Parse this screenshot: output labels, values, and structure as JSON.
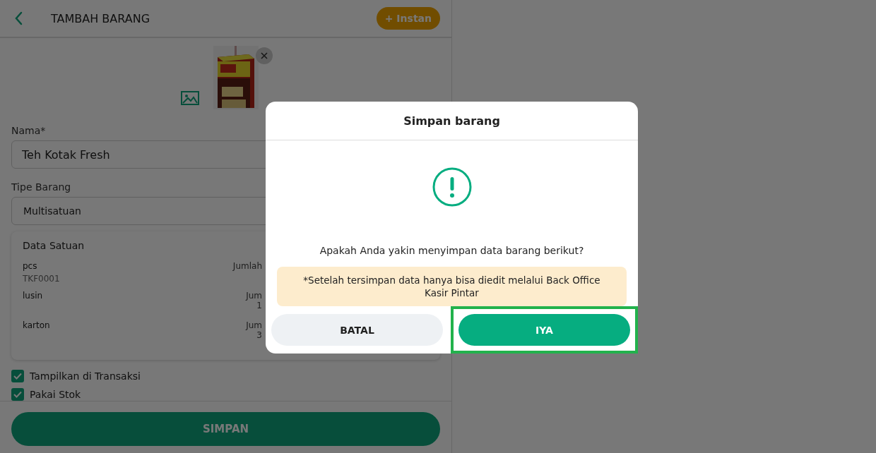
{
  "header": {
    "title": "TAMBAH BARANG",
    "instant_button": "+ Instan"
  },
  "form": {
    "name": {
      "label": "Nama*",
      "value": "Teh Kotak Fresh"
    },
    "type": {
      "label": "Tipe Barang",
      "value": "Multisatuan"
    }
  },
  "units": {
    "title": "Data Satuan",
    "rows": [
      {
        "unit": "pcs",
        "code": "TKF0001",
        "column_2": [
          "Jumlah"
        ]
      },
      {
        "unit": "lusin",
        "column_2": [
          "Jum",
          "1"
        ]
      },
      {
        "unit": "karton",
        "column_2": [
          "Jum",
          "3"
        ]
      }
    ]
  },
  "options": [
    {
      "label": "Tampilkan di Transaksi",
      "checked": true
    },
    {
      "label": "Pakai Stok",
      "checked": true
    }
  ],
  "save_button": "SIMPAN",
  "dialog": {
    "title": "Simpan barang",
    "message": "Apakah Anda yakin menyimpan data barang berikut?",
    "note": "*Setelah tersimpan data hanya bisa diedit melalui Back Office Kasir Pintar",
    "buttons": [
      {
        "label": "BATAL",
        "kind": "secondary",
        "highlighted": false
      },
      {
        "label": "IYA",
        "kind": "primary",
        "highlighted": true
      }
    ]
  }
}
